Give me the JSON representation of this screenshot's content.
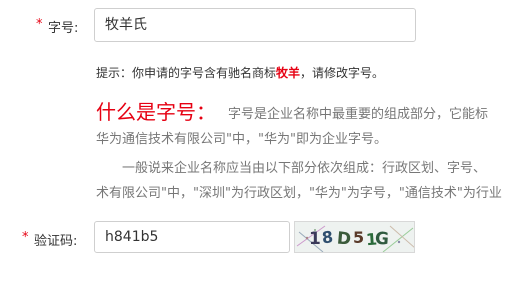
{
  "form": {
    "name_field": {
      "required_mark": "*",
      "label": "字号:",
      "value": "牧羊氏"
    },
    "hint": {
      "prefix": "提示：你申请的字号含有驰名商标",
      "keyword": "牧羊",
      "suffix": "，请修改字号。"
    },
    "explanation": {
      "title": "什么是字号：",
      "line1": "字号是企业名称中最重要的组成部分，它能标",
      "line2": "华为通信技术有限公司\"中，\"华为\"即为企业字号。",
      "line3": "一般说来企业名称应当由以下部分依次组成：行政区划、字号、",
      "line4": "术有限公司\"中，\"深圳\"为行政区划，\"华为\"为字号，\"通信技术\"为行业"
    },
    "captcha_field": {
      "required_mark": "*",
      "label": "验证码:",
      "value": "h841b5",
      "captcha_text": "18D51G"
    }
  },
  "colors": {
    "required": "#e60012",
    "keyword": "#e60012",
    "title": "#e60012",
    "muted": "#777777"
  }
}
